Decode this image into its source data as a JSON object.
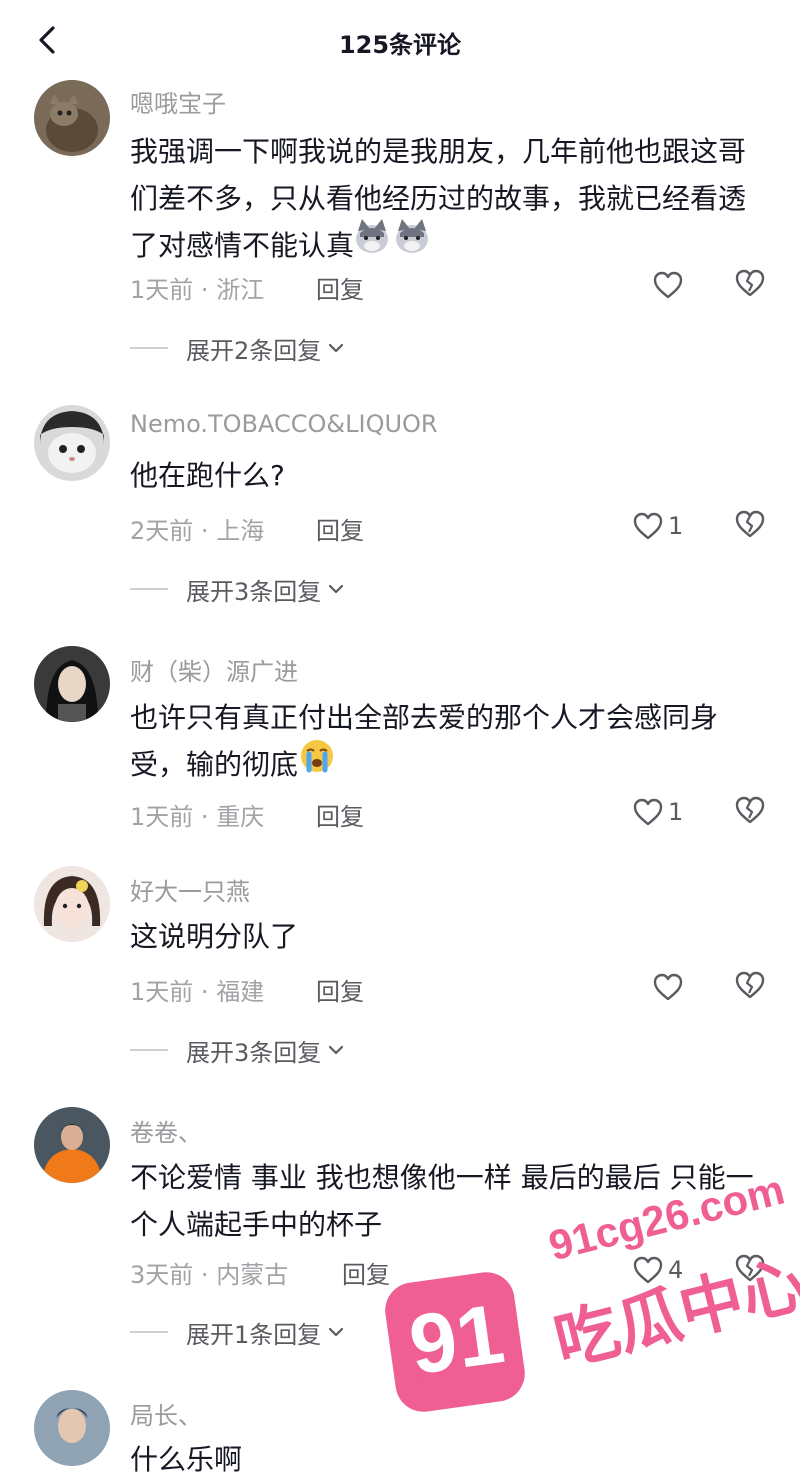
{
  "header": {
    "title": "125条评论"
  },
  "comments": [
    {
      "username": "嗯哦宝子",
      "text": "我强调一下啊我说的是我朋友，几年前他也跟这哥们差不多，只从看他经历过的故事，我就已经看透了对感情不能认真",
      "emoji": "dog-face-emoji ×2",
      "time": "1天前",
      "location": "浙江",
      "reply_label": "回复",
      "likes": "",
      "expand_label": "展开2条回复"
    },
    {
      "username": "Nemo.TOBACCO&LIQUOR",
      "text": "他在跑什么?",
      "time": "2天前",
      "location": "上海",
      "reply_label": "回复",
      "likes": "1",
      "expand_label": "展开3条回复"
    },
    {
      "username": "财（柴）源广进",
      "text": "也许只有真正付出全部去爱的那个人才会感同身受，输的彻底",
      "emoji": "crying-face-emoji",
      "time": "1天前",
      "location": "重庆",
      "reply_label": "回复",
      "likes": "1",
      "expand_label": ""
    },
    {
      "username": "好大一只燕",
      "text": "这说明分队了",
      "time": "1天前",
      "location": "福建",
      "reply_label": "回复",
      "likes": "",
      "expand_label": "展开3条回复"
    },
    {
      "username": "卷卷、",
      "text": "不论爱情 事业 我也想像他一样 最后的最后 只能一个人端起手中的杯子",
      "time": "3天前",
      "location": "内蒙古",
      "reply_label": "回复",
      "likes": "4",
      "expand_label": "展开1条回复"
    },
    {
      "username": "局长、",
      "text": "什么乐啊"
    }
  ],
  "meta_separator": "·",
  "watermark": {
    "badge": "91",
    "url": "91cg26.com",
    "name": "吃瓜中心"
  },
  "icons": {
    "back": "chevron-left-icon",
    "like": "heart-outline-icon",
    "dislike": "broken-heart-icon",
    "expand": "chevron-down-icon"
  },
  "colors": {
    "accent_watermark": "#ef5f93",
    "meta_text": "#a2a2a7",
    "username_text": "#9a9a9f"
  }
}
